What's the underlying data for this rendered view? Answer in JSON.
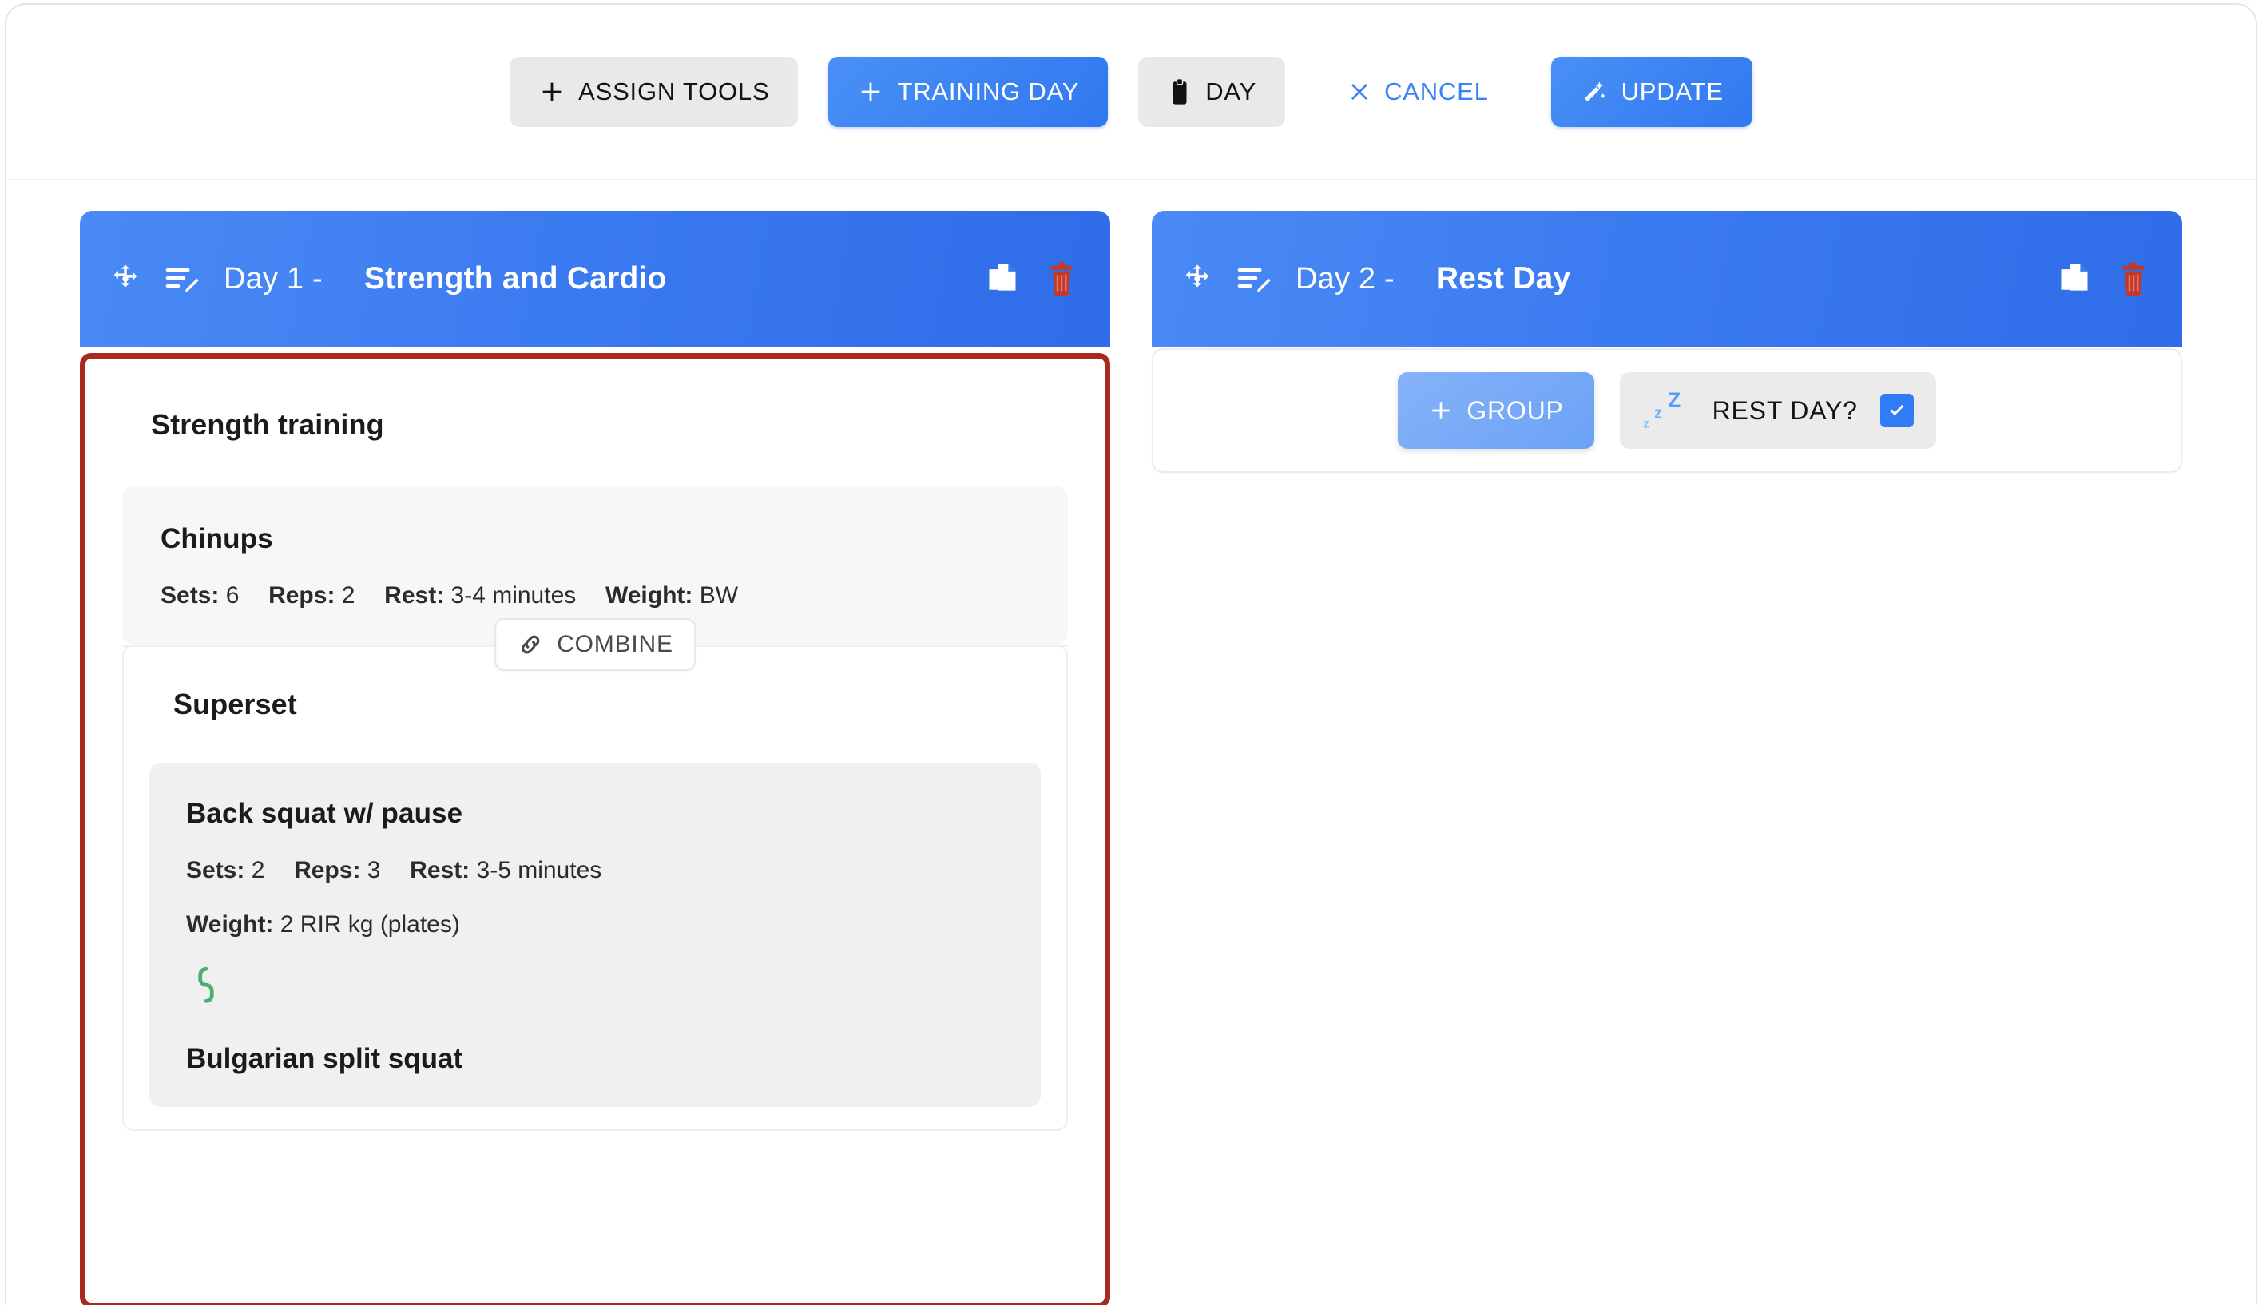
{
  "toolbar": {
    "assign_tools_label": "ASSIGN TOOLS",
    "training_day_label": "TRAINING DAY",
    "day_label": "DAY",
    "cancel_label": "CANCEL",
    "update_label": "UPDATE"
  },
  "colors": {
    "accent_blue": "#3b82f6",
    "header_blue_start": "#4a8af5",
    "header_blue_end": "#2f6ce9",
    "danger_red": "#a8291d",
    "trash_red": "#c0392b",
    "link_green": "#4caf72",
    "card_grey": "#f7f7f8",
    "subcard_grey": "#f0f0f1"
  },
  "days": [
    {
      "prefix": "Day 1 -",
      "title": "Strength and Cardio",
      "selected": true,
      "sections": [
        {
          "title": "Strength training",
          "exercises": [
            {
              "name": "Chinups",
              "meta": [
                {
                  "label": "Sets:",
                  "value": "6"
                },
                {
                  "label": "Reps:",
                  "value": "2"
                },
                {
                  "label": "Rest:",
                  "value": "3-4 minutes"
                },
                {
                  "label": "Weight:",
                  "value": "BW"
                }
              ]
            }
          ]
        }
      ],
      "combine_label": "COMBINE",
      "group": {
        "title": "Superset",
        "exercises": [
          {
            "name": "Back squat w/ pause",
            "meta_line1": [
              {
                "label": "Sets:",
                "value": "2"
              },
              {
                "label": "Reps:",
                "value": "3"
              },
              {
                "label": "Rest:",
                "value": "3-5 minutes"
              }
            ],
            "meta_line2": [
              {
                "label": "Weight:",
                "value": "2 RIR kg (plates)"
              }
            ]
          },
          {
            "name": "Bulgarian split squat"
          }
        ]
      }
    },
    {
      "prefix": "Day 2 -",
      "title": "Rest Day",
      "selected": false,
      "group_button_label": "GROUP",
      "rest_day_label": "REST DAY?",
      "rest_day_checked": true
    }
  ]
}
